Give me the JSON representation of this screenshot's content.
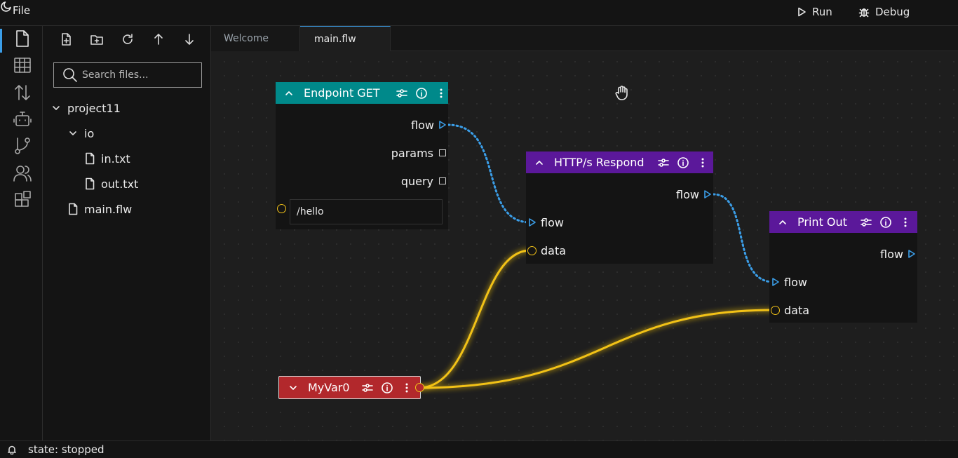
{
  "menu": {
    "file": "File"
  },
  "toolbar": {
    "run": "Run",
    "debug": "Debug"
  },
  "activity": [
    "files-icon",
    "table-icon",
    "sort-icon",
    "robot-icon",
    "git-branch-icon",
    "users-icon",
    "extensions-icon"
  ],
  "explorer": {
    "search_placeholder": "Search files...",
    "tree": {
      "project": "project11",
      "folder_io": "io",
      "file_in": "in.txt",
      "file_out": "out.txt",
      "file_main": "main.flw"
    }
  },
  "tabs": {
    "welcome": "Welcome",
    "main": "main.flw"
  },
  "nodes": {
    "endpoint": {
      "title": "Endpoint GET",
      "flow": "flow",
      "params": "params",
      "query": "query",
      "path_value": "/hello",
      "color": "#00898a"
    },
    "http": {
      "title": "HTTP/s Respond",
      "flow_out": "flow",
      "flow_in": "flow",
      "data_in": "data",
      "color": "#5b189a"
    },
    "print": {
      "title": "Print Out",
      "flow_out": "flow",
      "flow_in": "flow",
      "data_in": "data",
      "color": "#5b189a"
    },
    "myvar": {
      "title": "MyVar0",
      "color": "#b2282c"
    }
  },
  "wire_colors": {
    "flow": "#3b9ee8",
    "data": "#f2c218"
  },
  "status": {
    "text": "state: stopped"
  }
}
